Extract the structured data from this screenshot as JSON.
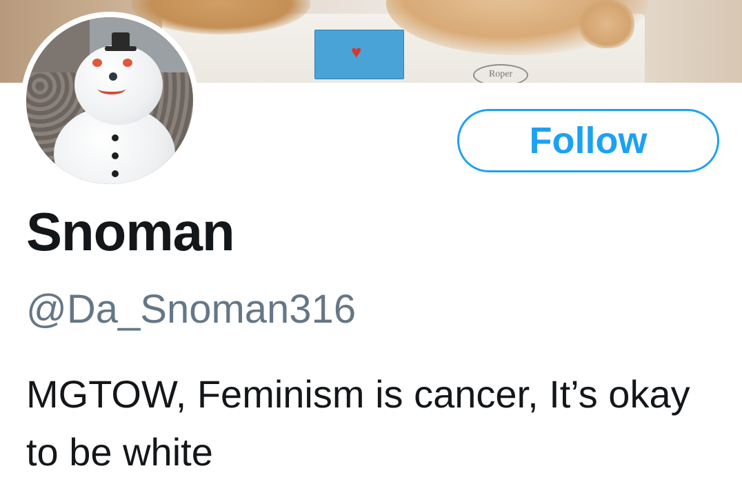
{
  "profile": {
    "display_name": "Snoman",
    "handle": "@Da_Snoman316",
    "bio": "MGTOW, Feminism is cancer, It’s okay to be white"
  },
  "actions": {
    "follow_label": "Follow"
  },
  "banner": {
    "appliance_brand": "Roper"
  },
  "colors": {
    "accent": "#1da1f2",
    "name_text": "#14171a",
    "handle_text": "#657786",
    "background": "#ffffff"
  }
}
